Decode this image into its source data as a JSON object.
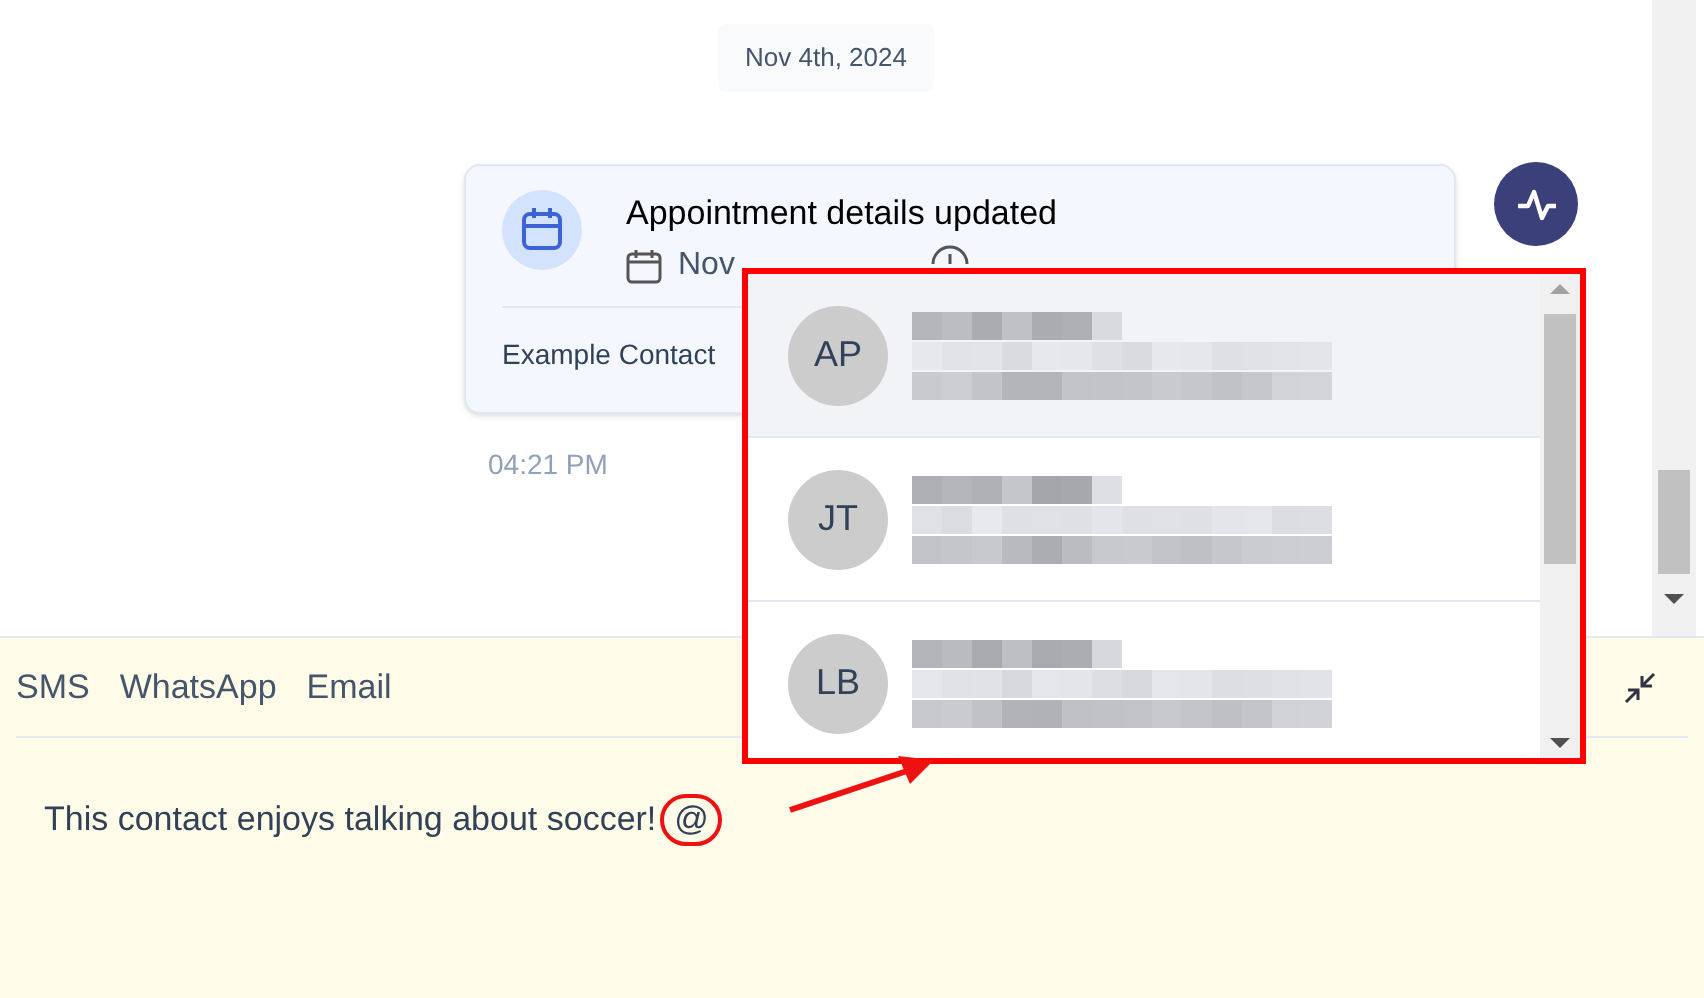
{
  "date_divider": "Nov 4th, 2024",
  "event_card": {
    "title": "Appointment details updated",
    "date": "Nov",
    "contact": "Example Contact",
    "timestamp": "04:21 PM"
  },
  "composer": {
    "channels": [
      "SMS",
      "WhatsApp",
      "Email"
    ],
    "message": "This contact enjoys talking about soccer!",
    "mention_trigger": "@"
  },
  "mention_dropdown": {
    "items": [
      {
        "initials": "AP",
        "selected": true
      },
      {
        "initials": "JT",
        "selected": false
      },
      {
        "initials": "LB",
        "selected": false
      }
    ]
  }
}
